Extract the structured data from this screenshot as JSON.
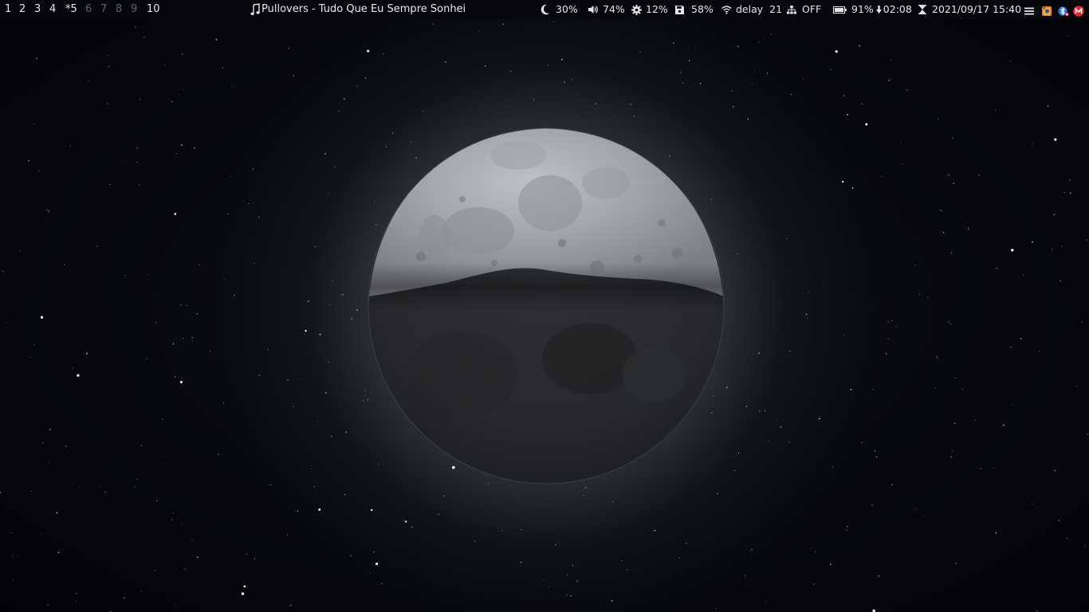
{
  "workspaces": [
    {
      "label": "1",
      "state": "occupied"
    },
    {
      "label": "2",
      "state": "occupied"
    },
    {
      "label": "3",
      "state": "occupied"
    },
    {
      "label": "4",
      "state": "occupied"
    },
    {
      "label": "*5",
      "state": "focused"
    },
    {
      "label": "6",
      "state": "empty"
    },
    {
      "label": "7",
      "state": "empty"
    },
    {
      "label": "8",
      "state": "empty"
    },
    {
      "label": "9",
      "state": "empty"
    },
    {
      "label": "10",
      "state": "occupied"
    }
  ],
  "now_playing": {
    "icon": "music-note-icon",
    "text": "Pullovers - Tudo Que Eu Sempre Sonhei"
  },
  "modules": {
    "brightness": {
      "icon": "moon-icon",
      "value": "30%"
    },
    "volume": {
      "icon": "speaker-icon",
      "value": "74%"
    },
    "cpu": {
      "icon": "gear-icon",
      "value": "12%"
    },
    "disk": {
      "icon": "floppy-disk-icon",
      "value": "58%"
    },
    "wifi": {
      "icon": "wifi-icon",
      "label": "delay",
      "value": "21"
    },
    "network": {
      "icon": "network-tree-icon",
      "value": "OFF"
    },
    "battery": {
      "icon": "battery-icon",
      "value": "91%",
      "time": "02:08"
    },
    "clock": {
      "icon": "hourglass-icon",
      "value": "2021/09/17 15:40"
    }
  },
  "tray": [
    "menu-icon",
    "firefox-icon",
    "bluetooth-icon",
    "mega-icon"
  ],
  "colors": {
    "bar_bg": "#06080c",
    "text": "#e6e6e6",
    "empty_workspace": "#5f636b",
    "mega_red": "#d9272e"
  }
}
